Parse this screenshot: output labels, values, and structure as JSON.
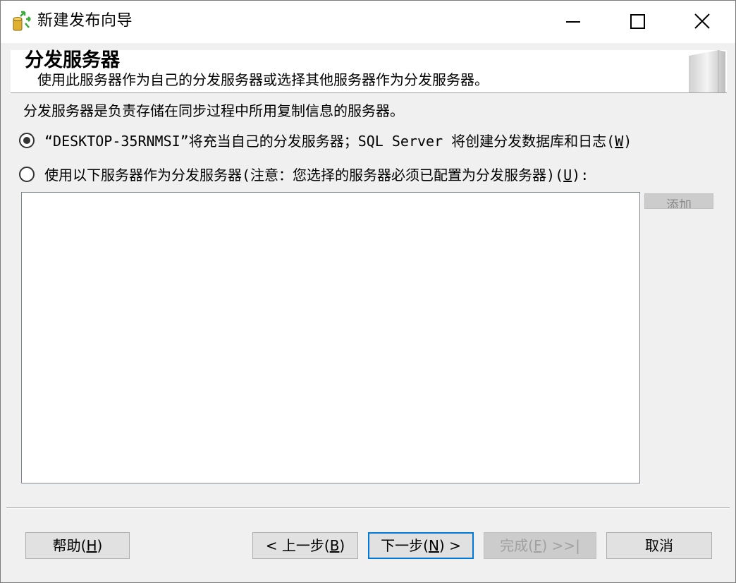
{
  "window": {
    "title": "新建发布向导",
    "minimize_icon": "minimize-icon",
    "maximize_icon": "maximize-icon",
    "close_icon": "close-icon"
  },
  "header": {
    "title": "分发服务器",
    "subtitle": "使用此服务器作为自己的分发服务器或选择其他服务器作为分发服务器。"
  },
  "description": "分发服务器是负责存储在同步过程中所用复制信息的服务器。",
  "options": [
    {
      "label_text": "“DESKTOP-35RNMSI”将充当自己的分发服务器；SQL Server 将创建分发数据库和日志(",
      "accel": "W",
      "label_end": ")",
      "selected": true
    },
    {
      "label_text": "使用以下服务器作为分发服务器(注意：您选择的服务器必须已配置为分发服务器)(",
      "accel": "U",
      "label_end": "):",
      "selected": false
    }
  ],
  "add_button": "添加",
  "buttons": {
    "help": {
      "label": "帮助(",
      "accel": "H",
      "end": ")"
    },
    "back": {
      "label": "< 上一步(",
      "accel": "B",
      "end": ")"
    },
    "next": {
      "label": "下一步(",
      "accel": "N",
      "end": ") >"
    },
    "finish": {
      "label": "完成(",
      "accel": "F",
      "end": ") >>|"
    },
    "cancel": {
      "label": "取消"
    }
  },
  "colors": {
    "accent": "#0078d7",
    "background": "#f0f0f0"
  }
}
